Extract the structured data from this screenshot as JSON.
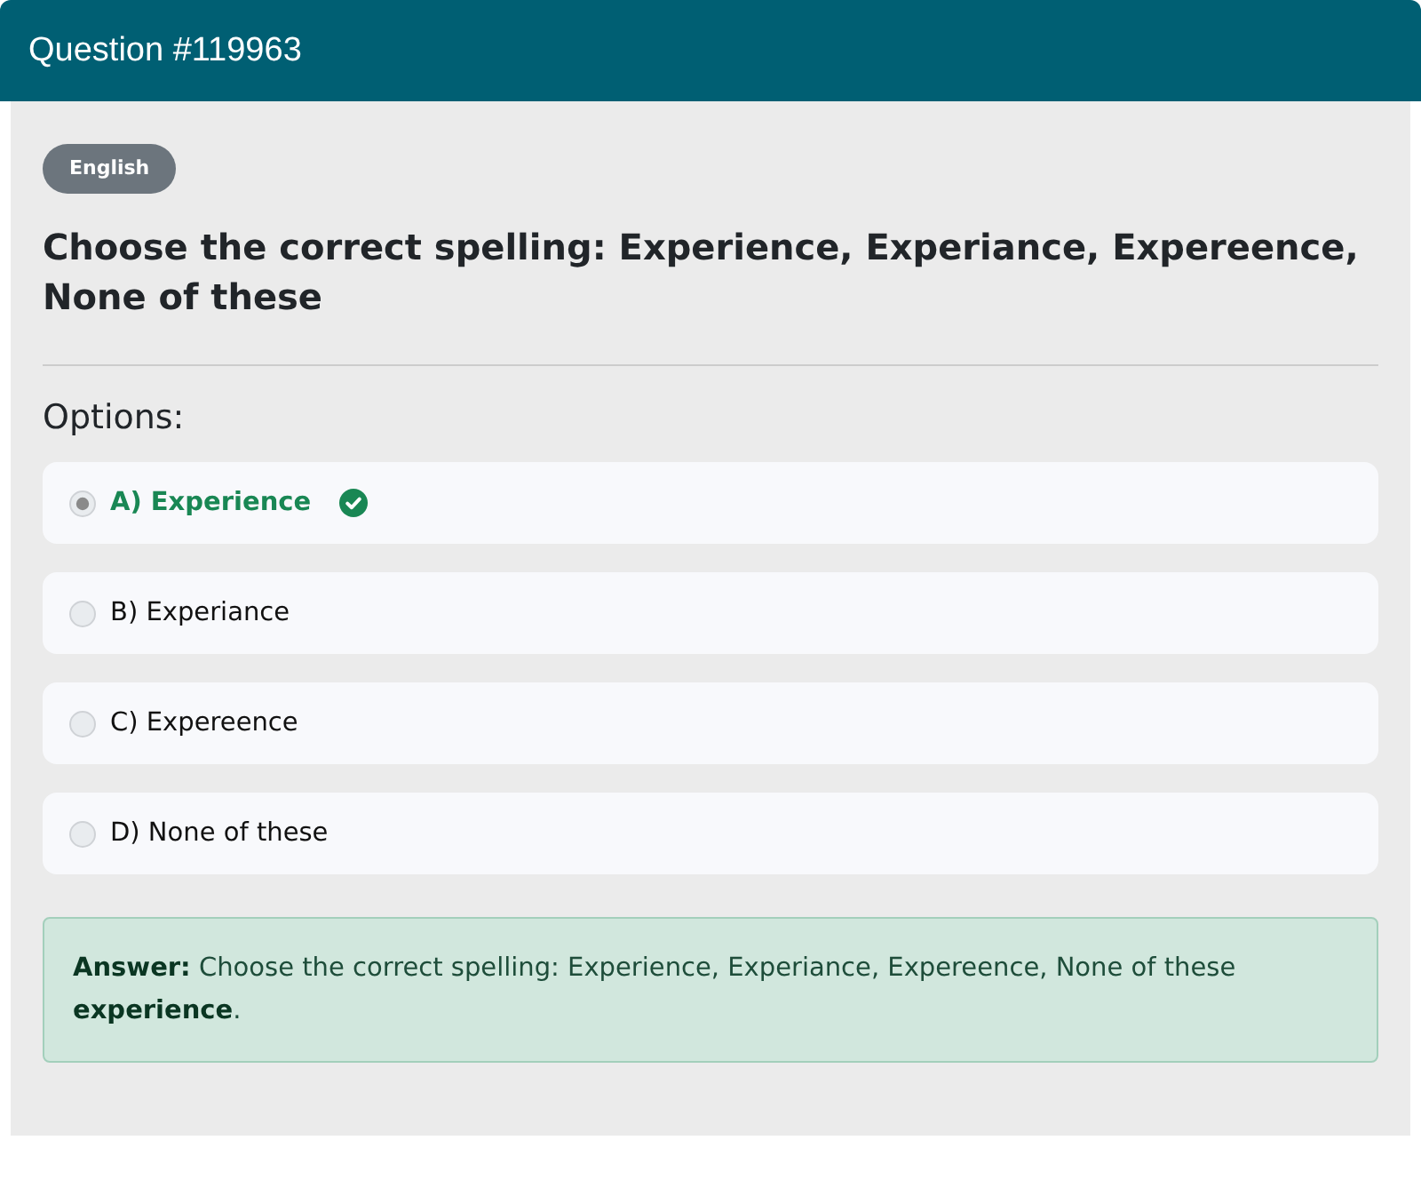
{
  "header": {
    "title": "Question #119963"
  },
  "question": {
    "subject_badge": "English",
    "text": "Choose the correct spelling: Experience, Experiance, Expereence, None of these"
  },
  "options_label": "Options:",
  "options": [
    {
      "label": "A) Experience",
      "selected": true,
      "correct": true
    },
    {
      "label": "B) Experiance",
      "selected": false,
      "correct": false
    },
    {
      "label": "C) Expereence",
      "selected": false,
      "correct": false
    },
    {
      "label": "D) None of these",
      "selected": false,
      "correct": false
    }
  ],
  "answer": {
    "lines": [
      "**Answer:** Choose the correct spelling: Experience, Experiance, Expereence, None of these",
      "**experience**."
    ]
  }
}
